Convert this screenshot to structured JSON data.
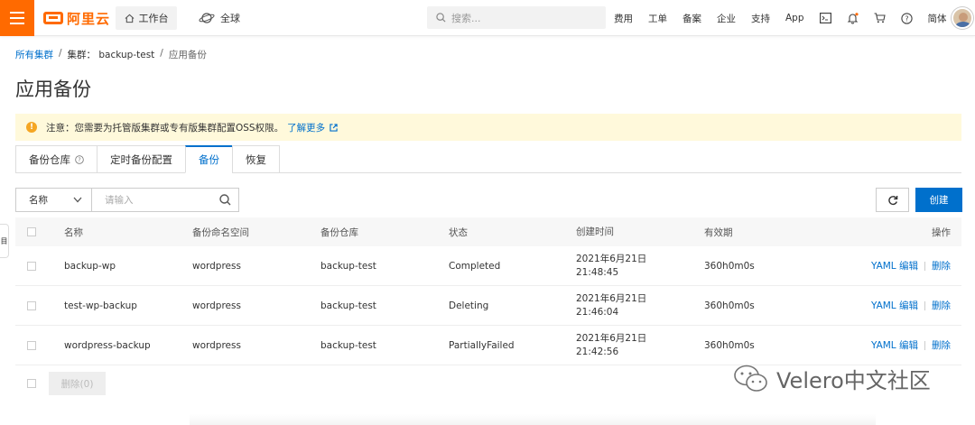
{
  "topbar": {
    "logo_text": "阿里云",
    "workbench_label": "工作台",
    "region_label": "全球",
    "search_placeholder": "搜索...",
    "nav_links": [
      "费用",
      "工单",
      "备案",
      "企业",
      "支持",
      "App"
    ],
    "lang_label": "简体",
    "accent_color": "#ff6a00"
  },
  "breadcrumb": {
    "root": "所有集群",
    "sep1": "/",
    "cluster": "集群： backup-test",
    "sep2": "/",
    "current": "应用备份"
  },
  "page_title": "应用备份",
  "notice": {
    "text": "注意：您需要为托管版集群或专有版集群配置OSS权限。",
    "link": "了解更多"
  },
  "tabs": [
    {
      "label": "备份仓库",
      "has_help": true
    },
    {
      "label": "定时备份配置"
    },
    {
      "label": "备份",
      "active": true
    },
    {
      "label": "恢复"
    }
  ],
  "filter": {
    "field": "名称",
    "placeholder": "请输入"
  },
  "toolbar": {
    "create_label": "创建"
  },
  "table": {
    "headers": {
      "name": "名称",
      "namespace": "备份命名空间",
      "repo": "备份仓库",
      "status": "状态",
      "created": "创建时间",
      "ttl": "有效期",
      "ops": "操作"
    },
    "rows": [
      {
        "name": "backup-wp",
        "namespace": "wordpress",
        "repo": "backup-test",
        "status": "Completed",
        "date": "2021年6月21日",
        "time": "21:48:45",
        "ttl": "360h0m0s",
        "yaml": "YAML 编辑",
        "delete": "删除"
      },
      {
        "name": "test-wp-backup",
        "namespace": "wordpress",
        "repo": "backup-test",
        "status": "Deleting",
        "date": "2021年6月21日",
        "time": "21:46:04",
        "ttl": "360h0m0s",
        "yaml": "YAML 编辑",
        "delete": "删除"
      },
      {
        "name": "wordpress-backup",
        "namespace": "wordpress",
        "repo": "backup-test",
        "status": "PartiallyFailed",
        "date": "2021年6月21日",
        "time": "21:42:56",
        "ttl": "360h0m0s",
        "yaml": "YAML 编辑",
        "delete": "删除"
      }
    ]
  },
  "bulk_delete_label": "删除(0)",
  "watermark": "Velero中文社区",
  "side_tab_label": "目"
}
